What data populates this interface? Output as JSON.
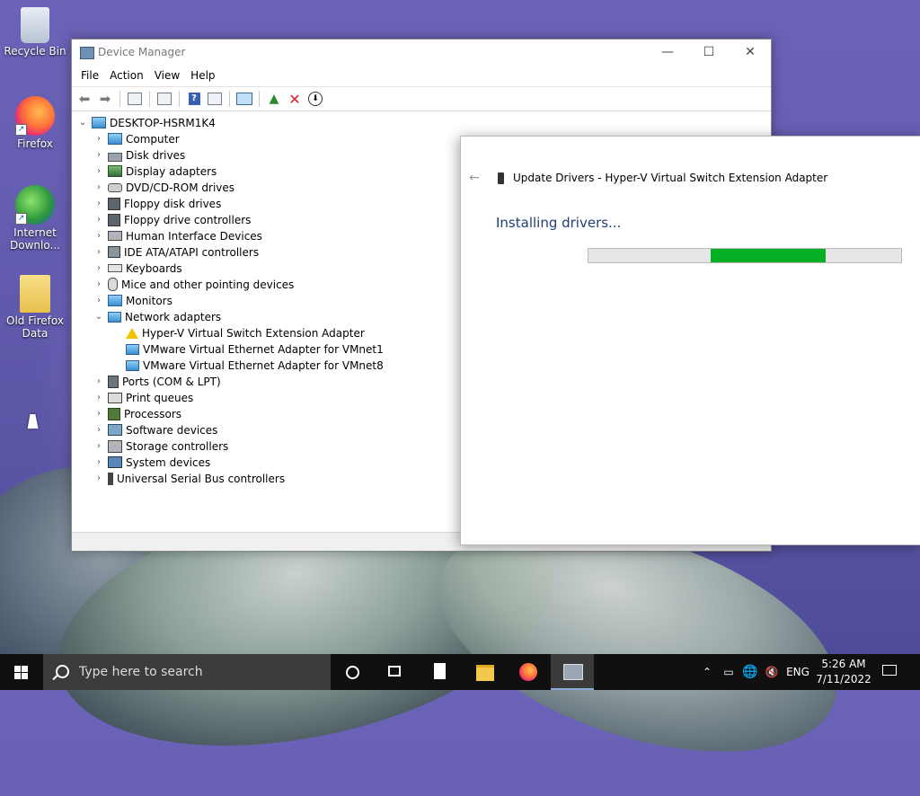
{
  "desktop": {
    "icons": [
      {
        "label": "Recycle Bin"
      },
      {
        "label": "Firefox"
      },
      {
        "label": "Internet Downlo..."
      },
      {
        "label": "Old Firefox Data"
      }
    ]
  },
  "device_manager": {
    "title": "Device Manager",
    "window_controls": {
      "minimize": "—",
      "maximize": "☐",
      "close": "✕"
    },
    "menu": [
      "File",
      "Action",
      "View",
      "Help"
    ],
    "tree": {
      "root": "DESKTOP-HSRM1K4",
      "categories": [
        {
          "label": "Computer",
          "icon": "computer-icon"
        },
        {
          "label": "Disk drives",
          "icon": "disk-drive-icon"
        },
        {
          "label": "Display adapters",
          "icon": "display-adapter-icon"
        },
        {
          "label": "DVD/CD-ROM drives",
          "icon": "dvd-drive-icon"
        },
        {
          "label": "Floppy disk drives",
          "icon": "floppy-disk-icon"
        },
        {
          "label": "Floppy drive controllers",
          "icon": "floppy-controller-icon"
        },
        {
          "label": "Human Interface Devices",
          "icon": "hid-icon"
        },
        {
          "label": "IDE ATA/ATAPI controllers",
          "icon": "ide-controller-icon"
        },
        {
          "label": "Keyboards",
          "icon": "keyboard-icon"
        },
        {
          "label": "Mice and other pointing devices",
          "icon": "mouse-icon"
        },
        {
          "label": "Monitors",
          "icon": "monitor-icon"
        },
        {
          "label": "Network adapters",
          "icon": "network-adapter-icon",
          "expanded": true
        },
        {
          "label": "Ports (COM & LPT)",
          "icon": "port-icon"
        },
        {
          "label": "Print queues",
          "icon": "printer-icon"
        },
        {
          "label": "Processors",
          "icon": "processor-icon"
        },
        {
          "label": "Software devices",
          "icon": "software-device-icon"
        },
        {
          "label": "Storage controllers",
          "icon": "storage-controller-icon"
        },
        {
          "label": "System devices",
          "icon": "system-device-icon"
        },
        {
          "label": "Universal Serial Bus controllers",
          "icon": "usb-icon"
        }
      ],
      "network_children": [
        {
          "label": "Hyper-V Virtual Switch Extension Adapter",
          "icon": "warning-icon"
        },
        {
          "label": "VMware Virtual Ethernet Adapter for VMnet1",
          "icon": "network-adapter-icon"
        },
        {
          "label": "VMware Virtual Ethernet Adapter for VMnet8",
          "icon": "network-adapter-icon"
        }
      ]
    }
  },
  "update_drivers": {
    "back_glyph": "←",
    "title": "Update Drivers - Hyper-V Virtual Switch Extension Adapter",
    "heading": "Installing drivers...",
    "progress_start": 0.39,
    "progress_end": 0.758,
    "colors": {
      "progress": "#06b025",
      "heading": "#1f3f73"
    }
  },
  "taskbar": {
    "search_placeholder": "Type here to search",
    "language": "ENG",
    "time": "5:26 AM",
    "date": "7/11/2022"
  }
}
